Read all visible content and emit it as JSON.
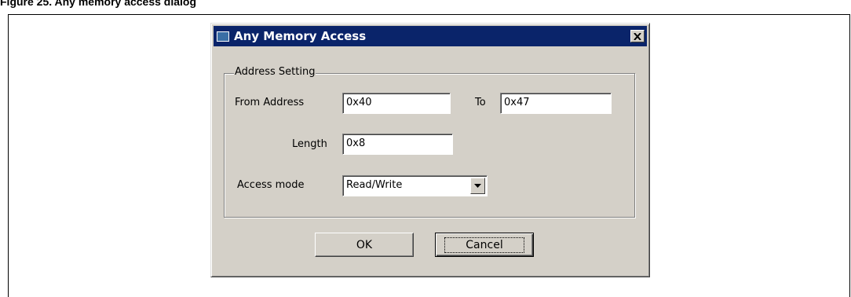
{
  "figure": {
    "caption": "Figure 25. Any memory access dialog"
  },
  "dialog": {
    "title": "Any Memory Access",
    "close_icon": "close-x-icon",
    "group_label": "Address Setting",
    "from_address": {
      "label": "From Address",
      "value": "0x40"
    },
    "to_address": {
      "label": "To",
      "value": "0x47"
    },
    "length": {
      "label": "Length",
      "value": "0x8"
    },
    "access_mode": {
      "label": "Access mode",
      "value": "Read/Write"
    },
    "buttons": {
      "ok": "OK",
      "cancel": "Cancel"
    }
  },
  "colors": {
    "titlebar": "#0a246a",
    "dialog_bg": "#d4d0c8"
  }
}
